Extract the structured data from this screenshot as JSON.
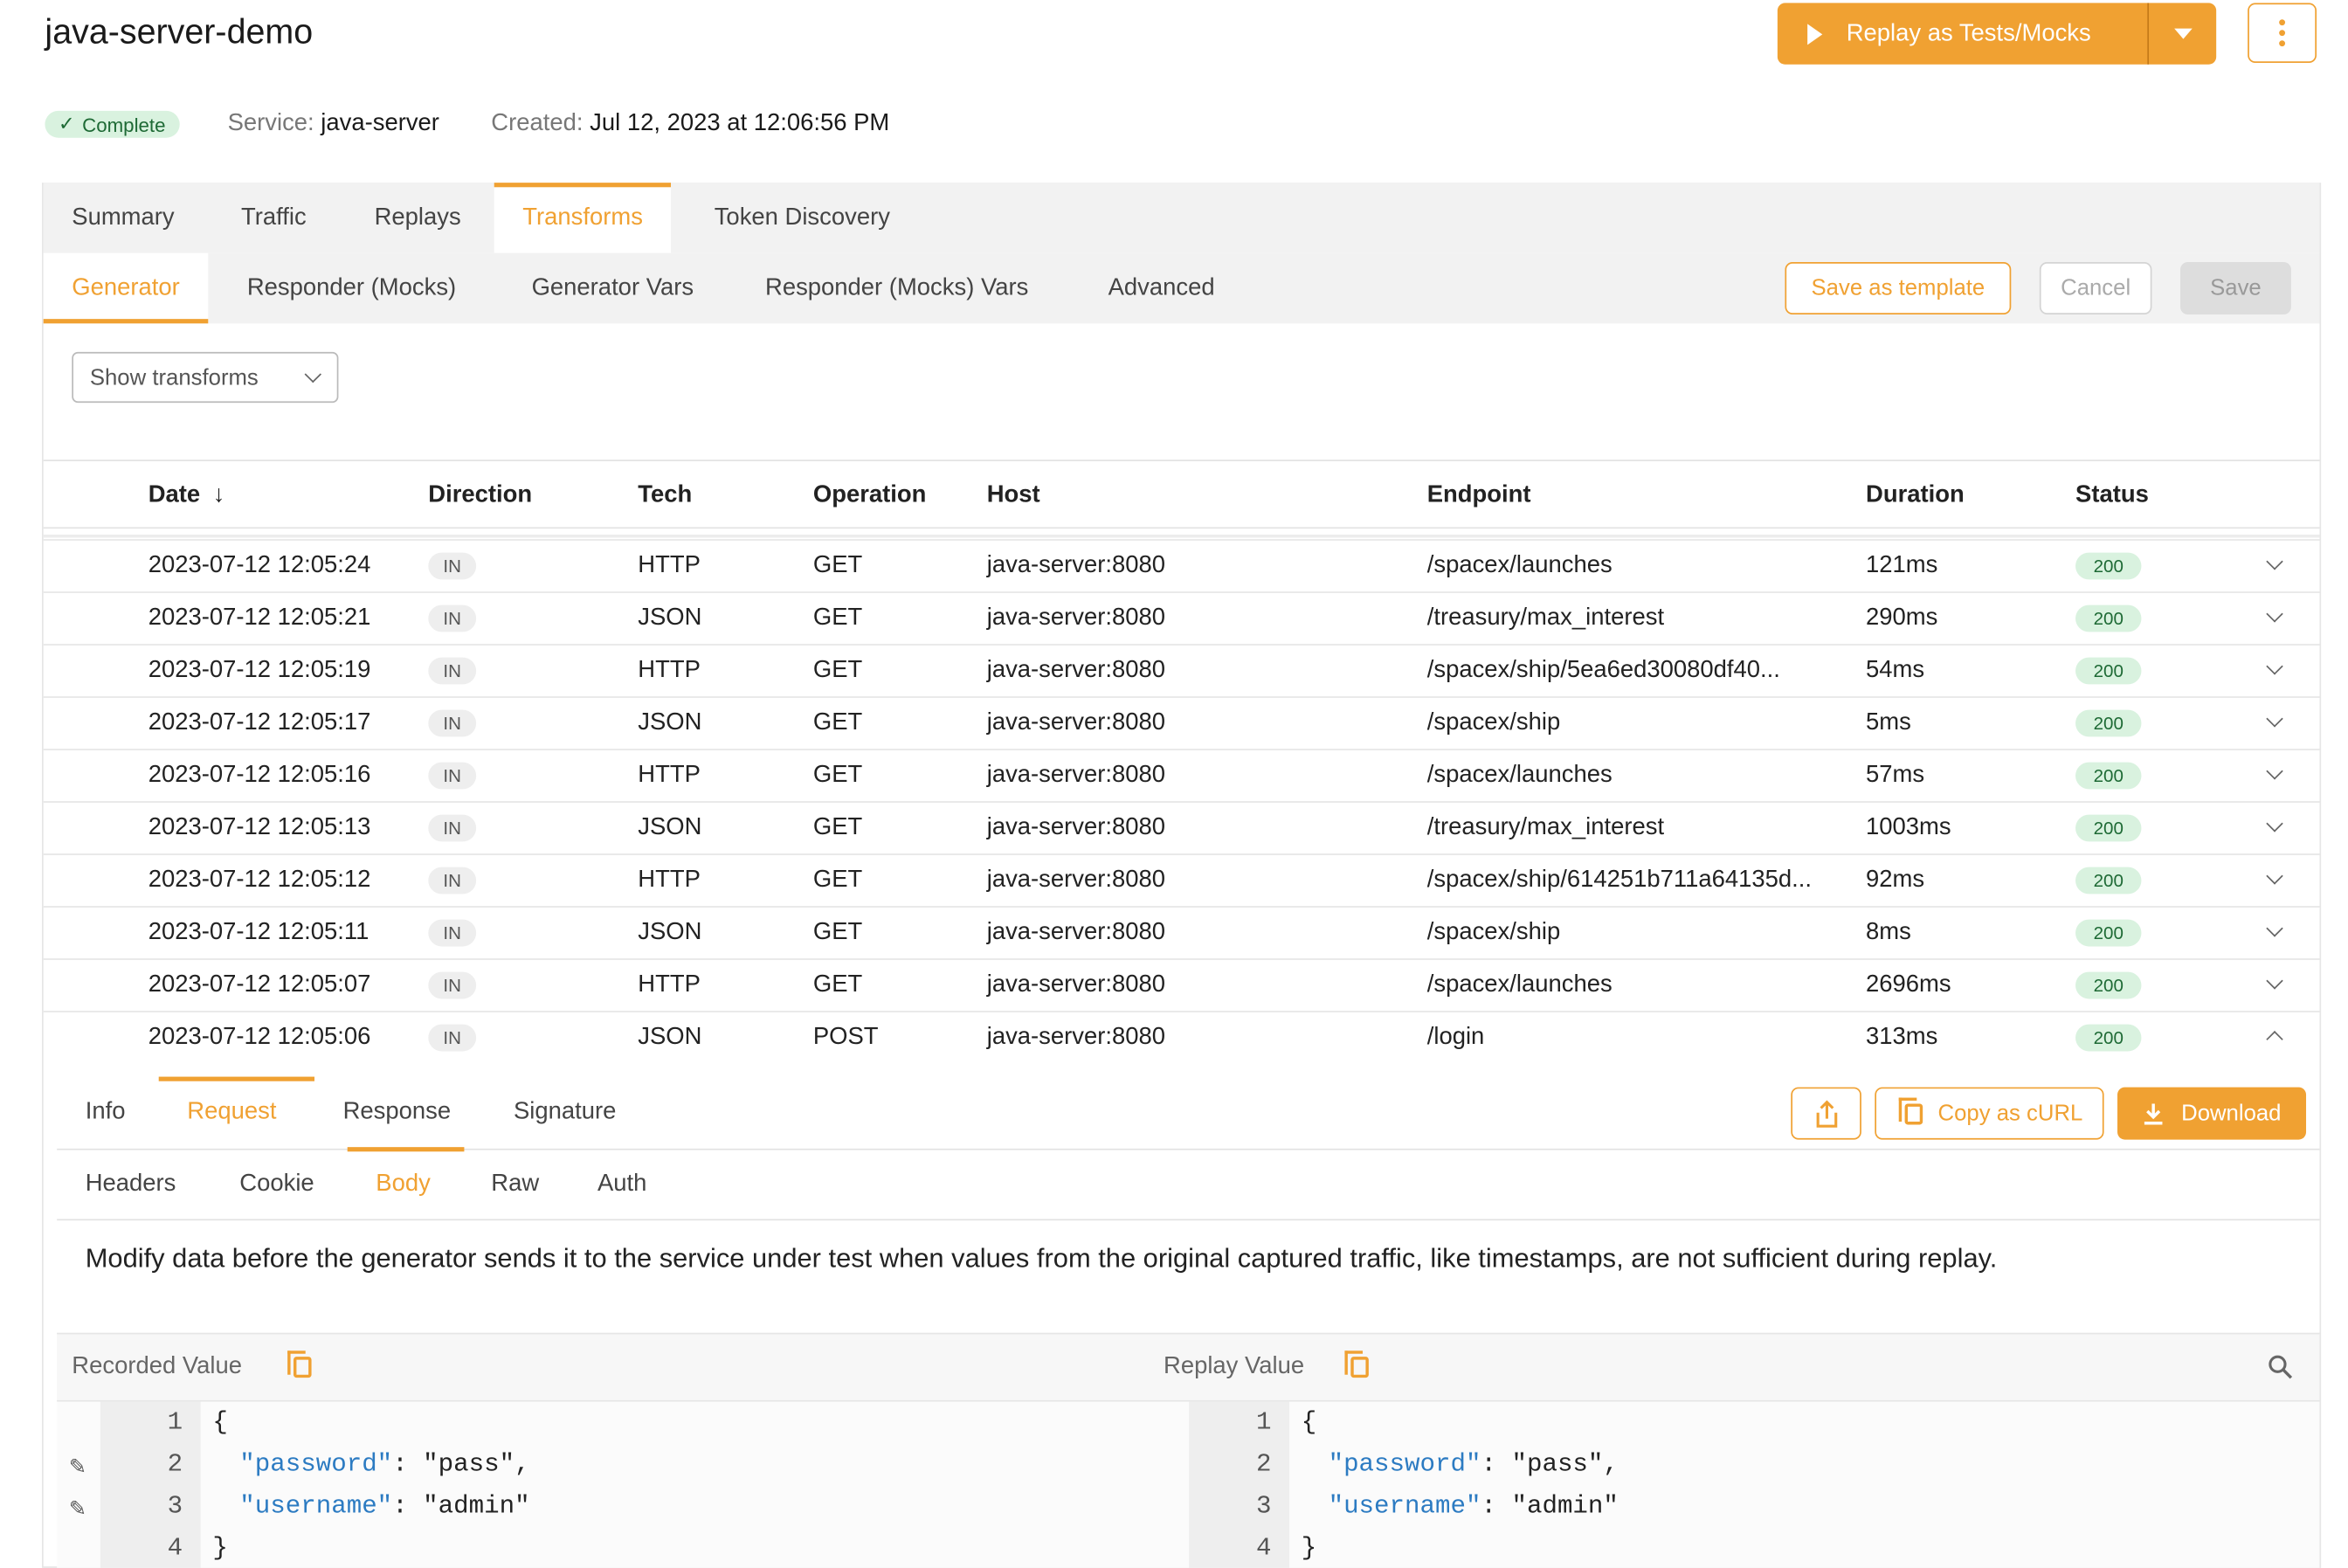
{
  "header": {
    "title": "java-server-demo",
    "replay_button": "Replay as Tests/Mocks",
    "status_badge": "Complete",
    "service_label": "Service:",
    "service_value": "java-server",
    "created_label": "Created:",
    "created_value": "Jul 12, 2023 at 12:06:56 PM"
  },
  "main_tabs": [
    "Summary",
    "Traffic",
    "Replays",
    "Transforms",
    "Token Discovery"
  ],
  "main_tab_active": "Transforms",
  "sub_tabs": [
    "Generator",
    "Responder (Mocks)",
    "Generator Vars",
    "Responder (Mocks) Vars",
    "Advanced"
  ],
  "sub_tab_active": "Generator",
  "actions": {
    "save_template": "Save as template",
    "cancel": "Cancel",
    "save": "Save"
  },
  "filter": {
    "show_transforms": "Show transforms"
  },
  "table": {
    "headers": [
      "Date",
      "Direction",
      "Tech",
      "Operation",
      "Host",
      "Endpoint",
      "Duration",
      "Status"
    ],
    "rows": [
      {
        "date": "2023-07-12 12:05:24",
        "dir": "IN",
        "tech": "HTTP",
        "op": "GET",
        "host": "java-server:8080",
        "endpoint": "/spacex/launches",
        "duration": "121ms",
        "status": "200"
      },
      {
        "date": "2023-07-12 12:05:21",
        "dir": "IN",
        "tech": "JSON",
        "op": "GET",
        "host": "java-server:8080",
        "endpoint": "/treasury/max_interest",
        "duration": "290ms",
        "status": "200"
      },
      {
        "date": "2023-07-12 12:05:19",
        "dir": "IN",
        "tech": "HTTP",
        "op": "GET",
        "host": "java-server:8080",
        "endpoint": "/spacex/ship/5ea6ed30080df40...",
        "duration": "54ms",
        "status": "200"
      },
      {
        "date": "2023-07-12 12:05:17",
        "dir": "IN",
        "tech": "JSON",
        "op": "GET",
        "host": "java-server:8080",
        "endpoint": "/spacex/ship",
        "duration": "5ms",
        "status": "200"
      },
      {
        "date": "2023-07-12 12:05:16",
        "dir": "IN",
        "tech": "HTTP",
        "op": "GET",
        "host": "java-server:8080",
        "endpoint": "/spacex/launches",
        "duration": "57ms",
        "status": "200"
      },
      {
        "date": "2023-07-12 12:05:13",
        "dir": "IN",
        "tech": "JSON",
        "op": "GET",
        "host": "java-server:8080",
        "endpoint": "/treasury/max_interest",
        "duration": "1003ms",
        "status": "200"
      },
      {
        "date": "2023-07-12 12:05:12",
        "dir": "IN",
        "tech": "HTTP",
        "op": "GET",
        "host": "java-server:8080",
        "endpoint": "/spacex/ship/614251b711a64135d...",
        "duration": "92ms",
        "status": "200"
      },
      {
        "date": "2023-07-12 12:05:11",
        "dir": "IN",
        "tech": "JSON",
        "op": "GET",
        "host": "java-server:8080",
        "endpoint": "/spacex/ship",
        "duration": "8ms",
        "status": "200"
      },
      {
        "date": "2023-07-12 12:05:07",
        "dir": "IN",
        "tech": "HTTP",
        "op": "GET",
        "host": "java-server:8080",
        "endpoint": "/spacex/launches",
        "duration": "2696ms",
        "status": "200"
      },
      {
        "date": "2023-07-12 12:05:06",
        "dir": "IN",
        "tech": "JSON",
        "op": "POST",
        "host": "java-server:8080",
        "endpoint": "/login",
        "duration": "313ms",
        "status": "200"
      }
    ]
  },
  "detail": {
    "tabs": [
      "Info",
      "Request",
      "Response",
      "Signature"
    ],
    "tab_active": "Request",
    "copy_curl": "Copy as cURL",
    "download": "Download",
    "body_tabs": [
      "Headers",
      "Cookie",
      "Body",
      "Raw",
      "Auth"
    ],
    "body_tab_active": "Body",
    "description": "Modify data before the generator sends it to the service under test when values from the original captured traffic, like timestamps, are not sufficient during replay.",
    "recorded_label": "Recorded Value",
    "replay_label": "Replay Value",
    "code_lines": [
      {
        "n": "1",
        "key": "",
        "rest": "{"
      },
      {
        "n": "2",
        "key": "\"password\"",
        "rest": ": \"pass\","
      },
      {
        "n": "3",
        "key": "\"username\"",
        "rest": ": \"admin\""
      },
      {
        "n": "4",
        "key": "",
        "rest": "}"
      }
    ]
  },
  "colors": {
    "accent": "#f0a132",
    "success_bg": "#d9f2df",
    "success_text": "#1e6a35",
    "json_key": "#2c7bc2"
  }
}
